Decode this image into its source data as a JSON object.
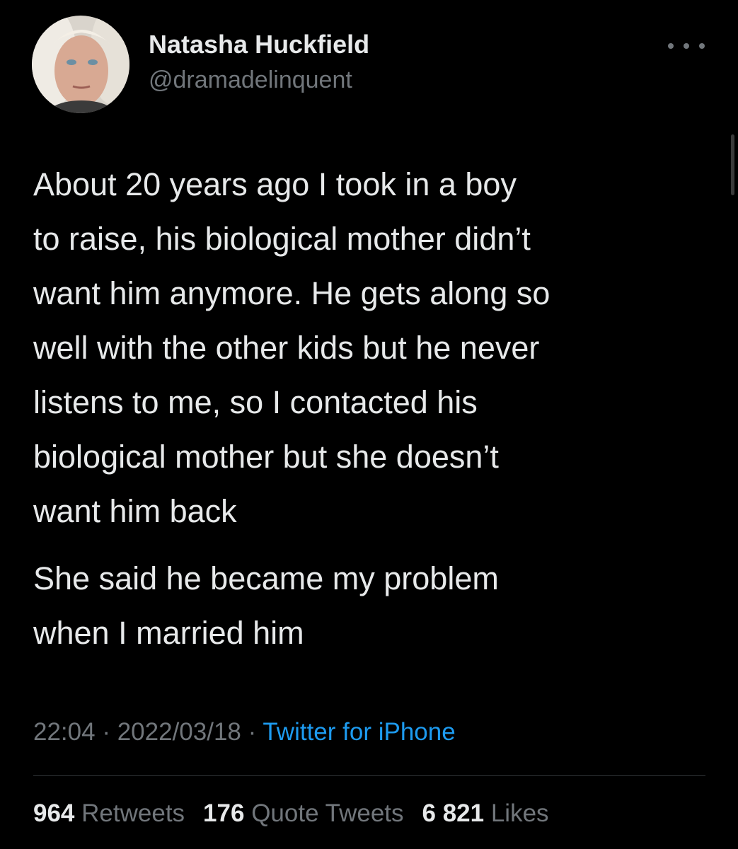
{
  "user": {
    "display_name": "Natasha Huckfield",
    "handle": "@dramadelinquent",
    "avatar_icon": "profile-photo"
  },
  "tweet": {
    "paragraphs": [
      "About 20 years ago I took in a boy\nto raise, his biological mother didn’t\nwant him anymore. He gets along so\nwell with the other kids but he never\nlistens to me, so I contacted his\nbiological mother but she doesn’t\nwant him back",
      "She said he became my problem\nwhen I married him"
    ]
  },
  "meta": {
    "time": "22:04",
    "date": "2022/03/18",
    "separator": " · ",
    "source": "Twitter for iPhone"
  },
  "stats": {
    "retweets_count": "964",
    "retweets_label": "Retweets",
    "quotes_count": "176",
    "quotes_label": "Quote Tweets",
    "likes_count": "6 821",
    "likes_label": "Likes"
  },
  "colors": {
    "background": "#000000",
    "text": "#e7e9ea",
    "secondary": "#71767b",
    "link": "#1d9bf0",
    "divider": "#2f3336"
  }
}
